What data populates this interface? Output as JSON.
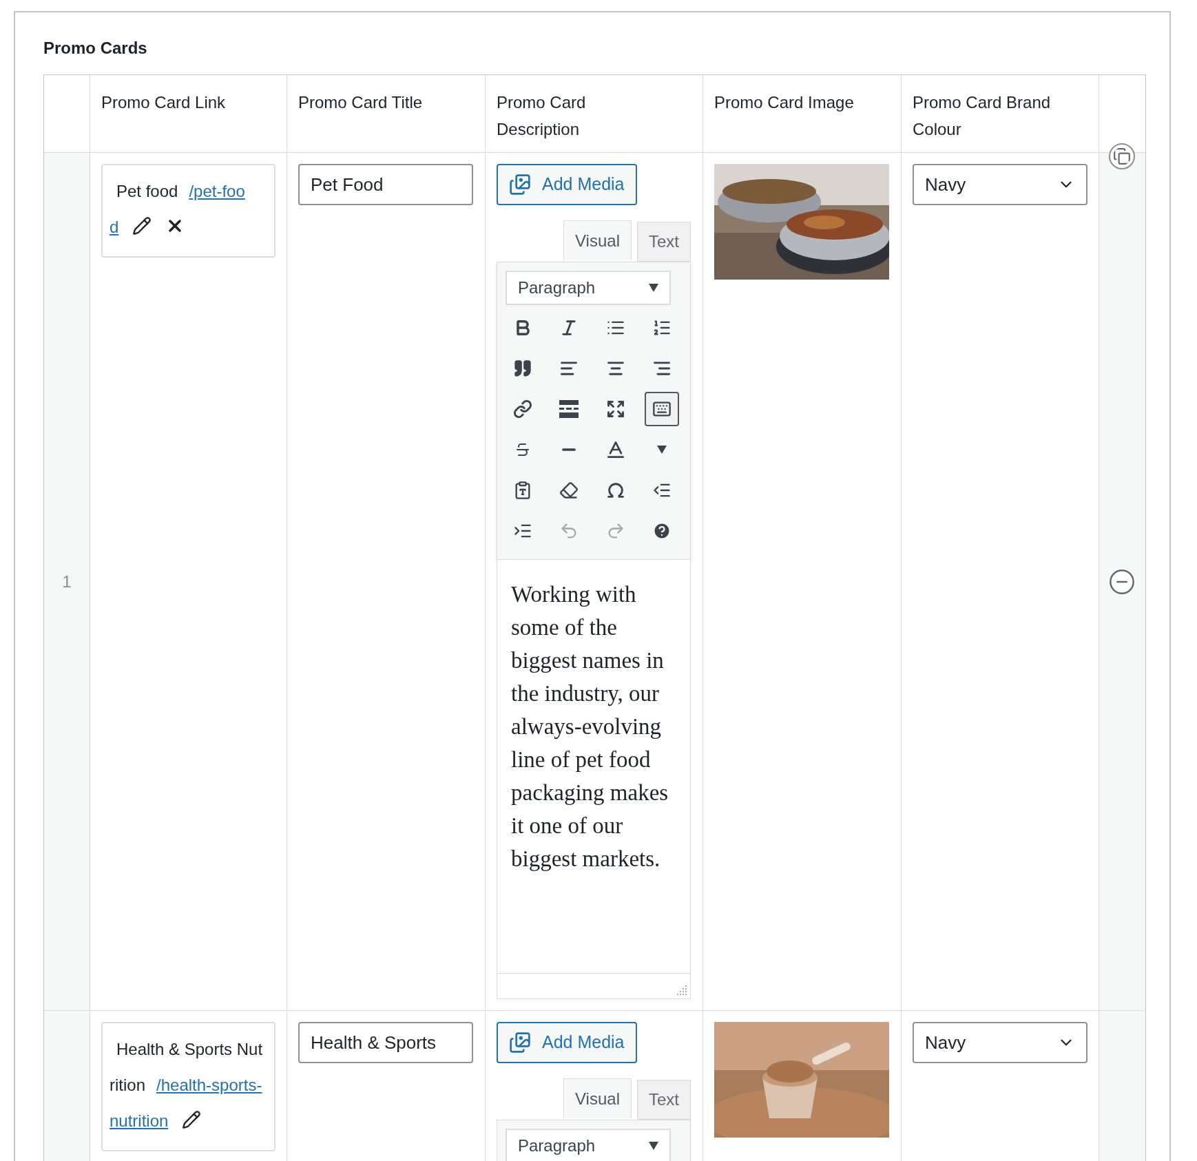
{
  "section_title": "Promo Cards",
  "columns": [
    "Promo Card Link",
    "Promo Card Title",
    "Promo Card Description",
    "Promo Card Image",
    "Promo Card Brand Colour"
  ],
  "rows": [
    {
      "number": "1",
      "hovered": true,
      "link": {
        "text": "Pet food",
        "url": "/pet-food",
        "removable": true
      },
      "title": "Pet Food",
      "add_media": "Add Media",
      "editor": {
        "tabs": [
          {
            "label": "Visual",
            "selected": true
          },
          {
            "label": "Text",
            "selected": false
          }
        ],
        "format": "Paragraph",
        "toolbar_toggle_on": true,
        "undo_disabled": true,
        "redo_disabled": true,
        "text": "Working with some of the biggest names in the industry, our always-evolving line of pet food packaging makes it one of our biggest markets."
      },
      "colour": "Navy"
    },
    {
      "hovered": false,
      "link": {
        "text": "Health & Sports Nutrition",
        "url": "/health-sports-nutrition",
        "removable": false
      },
      "title": "Health & Sports",
      "add_media": "Add Media",
      "editor": {
        "tabs": [
          {
            "label": "Visual",
            "selected": true
          },
          {
            "label": "Text",
            "selected": false
          }
        ],
        "format": "Paragraph"
      },
      "colour": "Navy"
    }
  ]
}
